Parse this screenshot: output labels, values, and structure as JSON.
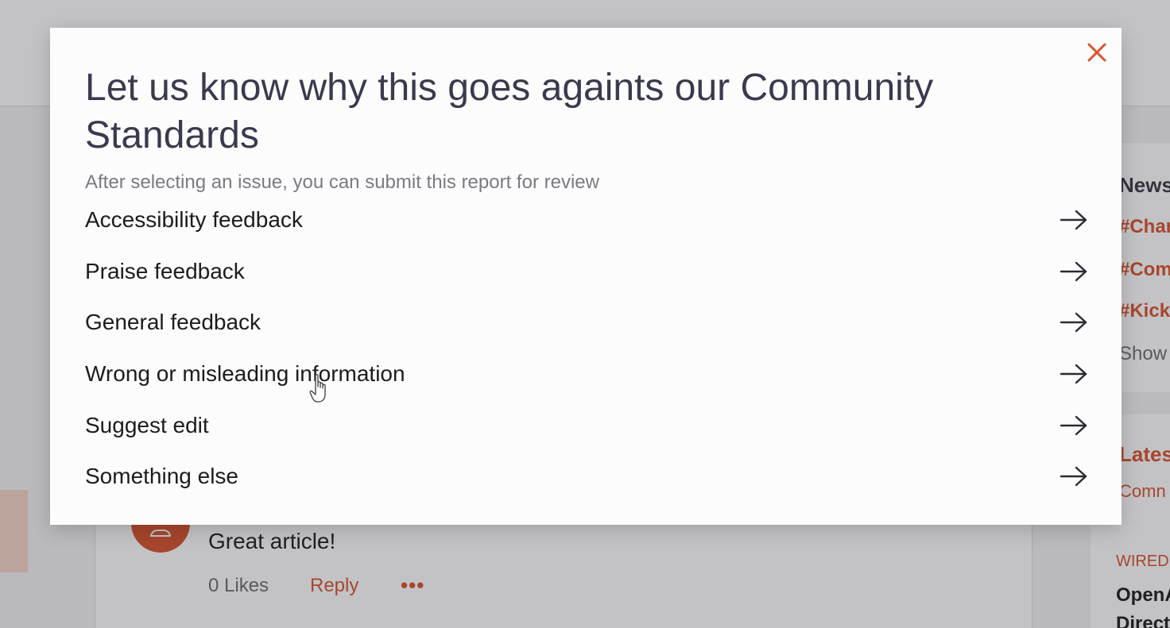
{
  "background": {
    "comment_text": "Great article!",
    "likes_label": "0 Likes",
    "reply_label": "Reply",
    "more_label": "•••",
    "sidebar": {
      "news_heading": "News",
      "tags": [
        "#Char",
        "#Com",
        "#Kick"
      ],
      "show_label": "Show",
      "latest_heading": "Lates",
      "comm_label": "Comn",
      "source_label": "WIRED",
      "article_line1": "OpenA",
      "article_line2": "Direct"
    },
    "colors": {
      "accent": "#d9532e",
      "title": "#3a3a4e"
    }
  },
  "modal": {
    "title": "Let us know why this goes againts our Community Standards",
    "subtitle": "After selecting an issue, you can submit this report for review",
    "close_icon": "close-icon",
    "options": [
      {
        "label": "Accessibility feedback",
        "icon": "arrow-right-icon"
      },
      {
        "label": "Praise feedback",
        "icon": "arrow-right-icon"
      },
      {
        "label": "General feedback",
        "icon": "arrow-right-icon"
      },
      {
        "label": "Wrong or misleading information",
        "icon": "arrow-right-icon"
      },
      {
        "label": "Suggest edit",
        "icon": "arrow-right-icon"
      },
      {
        "label": "Something else",
        "icon": "arrow-right-icon"
      }
    ]
  }
}
